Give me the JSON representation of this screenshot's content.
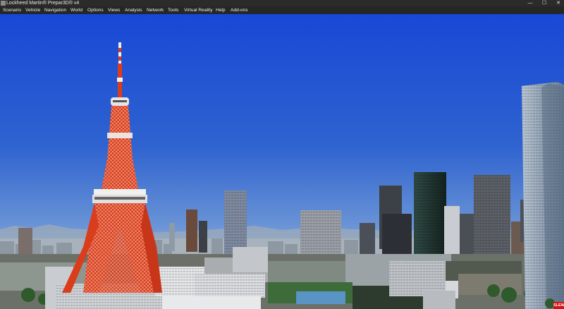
{
  "window": {
    "title": "Lockheed Martin® Prepar3D® v4",
    "minimize_glyph": "—",
    "maximize_glyph": "☐",
    "close_glyph": "✕",
    "icon": "app-icon"
  },
  "menu": {
    "items": [
      "Scenario",
      "Vehicle",
      "Navigation",
      "World",
      "Options",
      "Views",
      "Analysis",
      "Network",
      "Tools",
      "Virtual Reality",
      "Help",
      "Add-ons"
    ]
  },
  "status": {
    "slew_label": "SLEW",
    "slew_color": "#d51212"
  },
  "colors": {
    "sky_top": "#1a4ed8",
    "sky_horizon": "#b3cdea",
    "tower_red": "#d93d1c",
    "tower_white": "#efefef"
  }
}
